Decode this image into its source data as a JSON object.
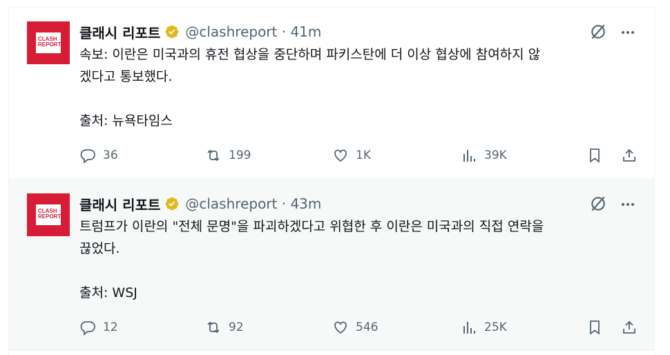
{
  "tweets": [
    {
      "author": {
        "name": "클래시 리포트",
        "handle": "@clashreport",
        "time": "41m",
        "avatar_text": [
          "CLASH",
          "REPORT"
        ]
      },
      "text": "속보: 이란은 미국과의 휴전 협상을 중단하며 파키스탄에 더 이상 협상에 참여하지 않\n겠다고 통보했다.\n\n출처: 뉴욕타임스",
      "stats": {
        "replies": "36",
        "retweets": "199",
        "likes": "1K",
        "views": "39K"
      }
    },
    {
      "author": {
        "name": "클래시 리포트",
        "handle": "@clashreport",
        "time": "43m",
        "avatar_text": [
          "CLASH",
          "REPORT"
        ]
      },
      "text": "트럼프가 이란의 \"전체 문명\"을 파괴하겠다고 위협한 후 이란은 미국과의 직접 연락을\n끊었다.\n\n출처: WSJ",
      "stats": {
        "replies": "12",
        "retweets": "92",
        "likes": "546",
        "views": "25K"
      }
    }
  ],
  "icons": {
    "verified": "verified-gold-icon",
    "grok": "grok-icon",
    "more": "more-icon",
    "reply": "reply-icon",
    "retweet": "retweet-icon",
    "like": "heart-icon",
    "views": "views-icon",
    "bookmark": "bookmark-icon",
    "share": "share-icon"
  },
  "colors": {
    "verified": "#e2b719",
    "muted": "#536471",
    "text": "#0f1419",
    "avatar": "#d71d36"
  }
}
